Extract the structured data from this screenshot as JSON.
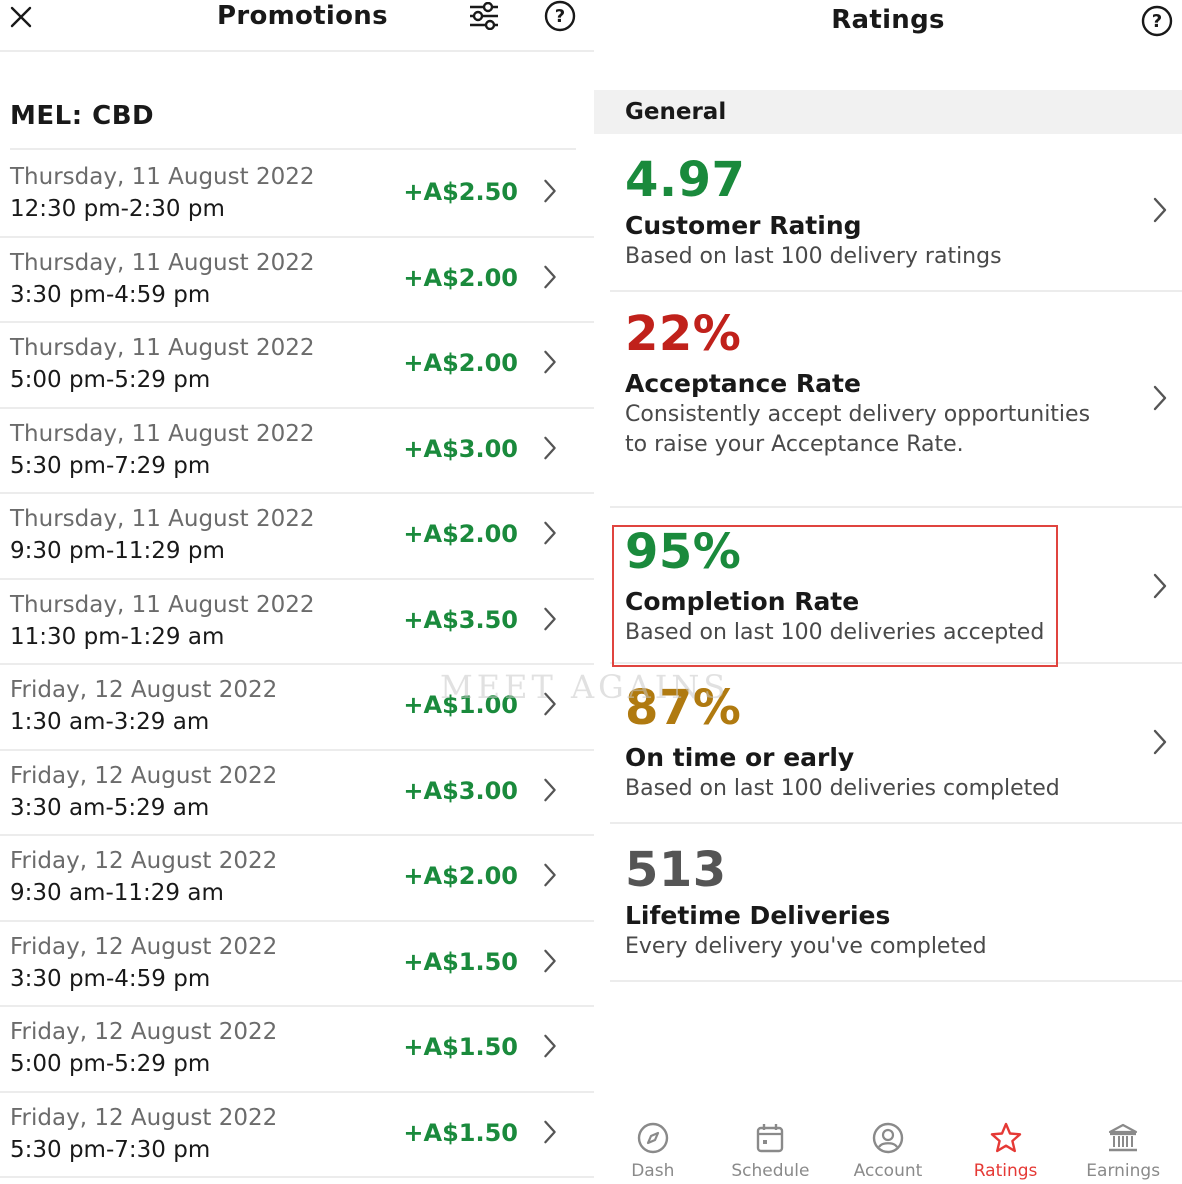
{
  "promotions": {
    "title": "Promotions",
    "region": "MEL: CBD",
    "items": [
      {
        "date": "Thursday, 11 August 2022",
        "time": "12:30 pm-2:30 pm",
        "amount": "+A$2.50"
      },
      {
        "date": "Thursday, 11 August 2022",
        "time": "3:30 pm-4:59 pm",
        "amount": "+A$2.00"
      },
      {
        "date": "Thursday, 11 August 2022",
        "time": "5:00 pm-5:29 pm",
        "amount": "+A$2.00"
      },
      {
        "date": "Thursday, 11 August 2022",
        "time": "5:30 pm-7:29 pm",
        "amount": "+A$3.00"
      },
      {
        "date": "Thursday, 11 August 2022",
        "time": "9:30 pm-11:29 pm",
        "amount": "+A$2.00"
      },
      {
        "date": "Thursday, 11 August 2022",
        "time": "11:30 pm-1:29 am",
        "amount": "+A$3.50"
      },
      {
        "date": "Friday, 12 August 2022",
        "time": "1:30 am-3:29 am",
        "amount": "+A$1.00"
      },
      {
        "date": "Friday, 12 August 2022",
        "time": "3:30 am-5:29 am",
        "amount": "+A$3.00"
      },
      {
        "date": "Friday, 12 August 2022",
        "time": "9:30 am-11:29 am",
        "amount": "+A$2.00"
      },
      {
        "date": "Friday, 12 August 2022",
        "time": "3:30 pm-4:59 pm",
        "amount": "+A$1.50"
      },
      {
        "date": "Friday, 12 August 2022",
        "time": "5:00 pm-5:29 pm",
        "amount": "+A$1.50"
      },
      {
        "date": "Friday, 12 August 2022",
        "time": "5:30 pm-7:30 pm",
        "amount": "+A$1.50"
      }
    ]
  },
  "ratings": {
    "title": "Ratings",
    "section": "General",
    "metrics": [
      {
        "value": "4.97",
        "title": "Customer Rating",
        "desc": "Based on last 100 delivery ratings",
        "color": "#1a8a3c"
      },
      {
        "value": "22%",
        "title": "Acceptance Rate",
        "desc": "Consistently accept delivery opportunities to raise your Acceptance Rate.",
        "color": "#c0211b"
      },
      {
        "value": "95%",
        "title": "Completion Rate",
        "desc": "Based on last 100 deliveries accepted",
        "color": "#1a8a3c"
      },
      {
        "value": "87%",
        "title": "On time or early",
        "desc": "Based on last 100 deliveries completed",
        "color": "#b07a10"
      },
      {
        "value": "513",
        "title": "Lifetime Deliveries",
        "desc": "Every delivery you've completed",
        "color": "#555555"
      }
    ]
  },
  "watermark": "MEET AGAINS",
  "nav": [
    {
      "label": "Dash",
      "icon": "compass-icon"
    },
    {
      "label": "Schedule",
      "icon": "calendar-icon"
    },
    {
      "label": "Account",
      "icon": "account-icon"
    },
    {
      "label": "Ratings",
      "icon": "star-icon",
      "active": true
    },
    {
      "label": "Earnings",
      "icon": "bank-icon"
    }
  ],
  "colors": {
    "accent": "#e53935",
    "positive": "#1a8a3c",
    "highlight_border": "#e0443f"
  }
}
